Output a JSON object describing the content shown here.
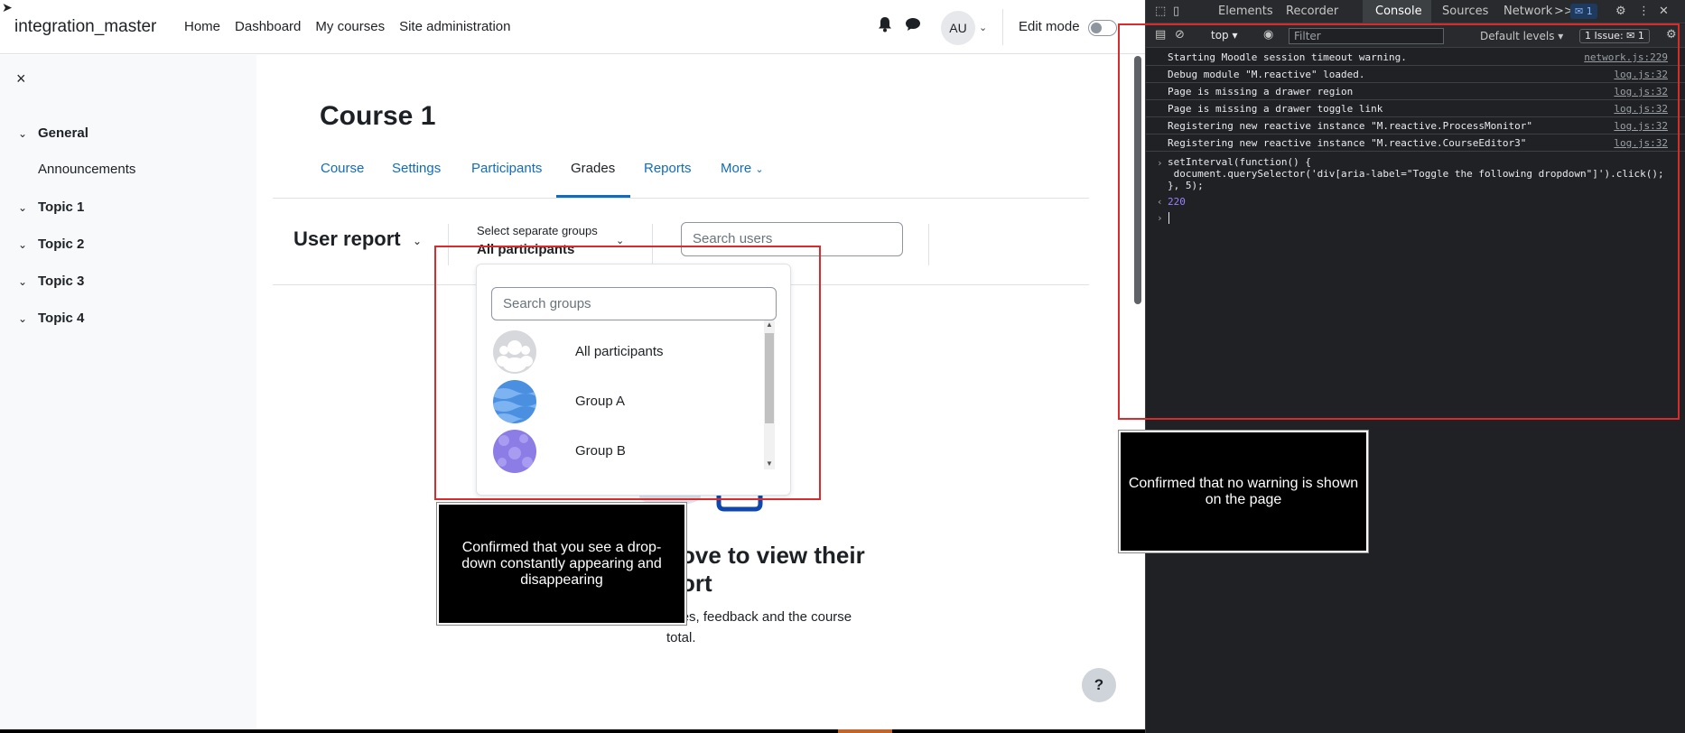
{
  "site": {
    "brand": "integration_master",
    "nav": [
      "Home",
      "Dashboard",
      "My courses",
      "Site administration"
    ],
    "avatar_initials": "AU",
    "edit_mode_label": "Edit mode"
  },
  "drawer": {
    "close_icon": "×",
    "sections": [
      {
        "label": "General",
        "children": [
          "Announcements"
        ]
      },
      {
        "label": "Topic 1"
      },
      {
        "label": "Topic 2"
      },
      {
        "label": "Topic 3"
      },
      {
        "label": "Topic 4"
      }
    ]
  },
  "course": {
    "title": "Course 1",
    "tabs": [
      "Course",
      "Settings",
      "Participants",
      "Grades",
      "Reports",
      "More"
    ],
    "active_tab": "Grades"
  },
  "report": {
    "title": "User report",
    "group_select_label": "Select separate groups",
    "group_select_value": "All participants",
    "search_users_placeholder": "Search users",
    "search_groups_placeholder": "Search groups",
    "groups": [
      "All participants",
      "Group A",
      "Group B"
    ],
    "empty_title_fragment_1": "ove to view their",
    "empty_title_fragment_2": "ort",
    "empty_desc_fragment_1": "ades, feedback and the course",
    "empty_desc_fragment_2": "total.",
    "help_label": "?"
  },
  "devtools": {
    "tabs": [
      "Elements",
      "Recorder",
      "Console",
      "Sources",
      "Network"
    ],
    "active_tab": "Console",
    "more_tabs": ">>",
    "issues_count_badge": "1",
    "context": "top",
    "filter_placeholder": "Filter",
    "levels": "Default levels",
    "issue_button": "1 Issue:",
    "issue_button_count": "1",
    "messages": [
      {
        "text": "Starting Moodle session timeout warning.",
        "source": "network.js:229"
      },
      {
        "text": "Debug module \"M.reactive\" loaded.",
        "source": "log.js:32"
      },
      {
        "text": "Page is missing a drawer region",
        "source": "log.js:32"
      },
      {
        "text": "Page is missing a drawer toggle link",
        "source": "log.js:32"
      },
      {
        "text": "Registering new reactive instance \"M.reactive.ProcessMonitor\"",
        "source": "log.js:32"
      },
      {
        "text": "Registering new reactive instance \"M.reactive.CourseEditor3\"",
        "source": "log.js:32"
      }
    ],
    "code_line_1": "setInterval(function() {",
    "code_line_2": " document.querySelector('div[aria-label=\"Toggle the following dropdown\"]').click();",
    "code_line_3": "}, 5);",
    "return_value": "220"
  },
  "annotations": {
    "note_dropdown": "Confirmed that you see a drop-down constantly appearing and disappearing",
    "note_warning": "Confirmed that no warning is shown on the page",
    "box_color": "#d92b2b"
  }
}
